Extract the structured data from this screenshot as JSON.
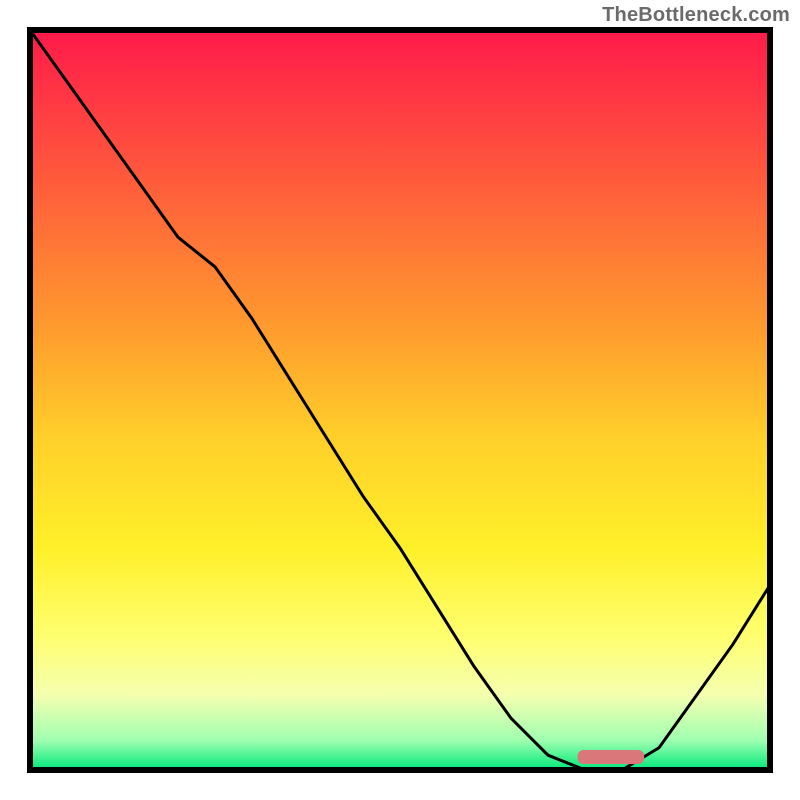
{
  "watermark": "TheBottleneck.com",
  "chart_data": {
    "type": "line",
    "title": "",
    "xlabel": "",
    "ylabel": "",
    "xlim": [
      0,
      100
    ],
    "ylim": [
      0,
      100
    ],
    "x": [
      0,
      5,
      10,
      15,
      20,
      25,
      30,
      35,
      40,
      45,
      50,
      55,
      60,
      65,
      70,
      75,
      80,
      85,
      90,
      95,
      100
    ],
    "values": [
      100,
      93,
      86,
      79,
      72,
      68,
      61,
      53,
      45,
      37,
      30,
      22,
      14,
      7,
      2,
      0,
      0,
      3,
      10,
      17,
      25
    ],
    "optimum_range": {
      "start": 74,
      "end": 83
    },
    "gradient_stops": [
      {
        "offset": 0.0,
        "color": "#ff1a4a"
      },
      {
        "offset": 0.2,
        "color": "#ff5a3c"
      },
      {
        "offset": 0.4,
        "color": "#ff9a2e"
      },
      {
        "offset": 0.55,
        "color": "#ffcf2a"
      },
      {
        "offset": 0.7,
        "color": "#fff02a"
      },
      {
        "offset": 0.82,
        "color": "#ffff70"
      },
      {
        "offset": 0.9,
        "color": "#f4ffb0"
      },
      {
        "offset": 0.96,
        "color": "#9fffb0"
      },
      {
        "offset": 1.0,
        "color": "#00e87a"
      }
    ],
    "marker_color": "#d9777a",
    "line_color": "#000000",
    "frame_color": "#000000"
  }
}
